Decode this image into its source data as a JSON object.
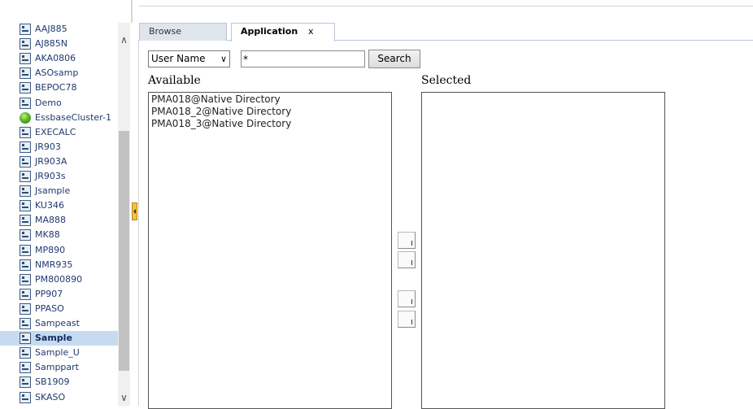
{
  "tree": {
    "items": [
      {
        "label": "AAJ885",
        "icon": "application-icon"
      },
      {
        "label": "AJ885N",
        "icon": "application-icon"
      },
      {
        "label": "AKA0806",
        "icon": "application-icon"
      },
      {
        "label": "ASOsamp",
        "icon": "application-icon"
      },
      {
        "label": "BEPOC78",
        "icon": "application-icon"
      },
      {
        "label": "Demo",
        "icon": "application-icon"
      },
      {
        "label": "EssbaseCluster-1",
        "icon": "cluster-icon"
      },
      {
        "label": "EXECALC",
        "icon": "application-icon"
      },
      {
        "label": "JR903",
        "icon": "application-icon"
      },
      {
        "label": "JR903A",
        "icon": "application-icon"
      },
      {
        "label": "JR903s",
        "icon": "application-icon"
      },
      {
        "label": "Jsample",
        "icon": "application-icon"
      },
      {
        "label": "KU346",
        "icon": "application-icon"
      },
      {
        "label": "MA888",
        "icon": "application-icon"
      },
      {
        "label": "MK88",
        "icon": "application-icon"
      },
      {
        "label": "MP890",
        "icon": "application-icon"
      },
      {
        "label": "NMR935",
        "icon": "application-icon"
      },
      {
        "label": "PM800890",
        "icon": "application-icon"
      },
      {
        "label": "PP907",
        "icon": "application-icon"
      },
      {
        "label": "PPASO",
        "icon": "application-icon"
      },
      {
        "label": "Sampeast",
        "icon": "application-icon"
      },
      {
        "label": "Sample",
        "icon": "application-icon",
        "selected": true
      },
      {
        "label": "Sample_U",
        "icon": "application-icon"
      },
      {
        "label": "Samppart",
        "icon": "application-icon"
      },
      {
        "label": "SB1909",
        "icon": "application-icon"
      },
      {
        "label": "SKASO",
        "icon": "application-icon"
      }
    ],
    "scroll_up_icon": "chevron-up-icon",
    "scroll_down_icon": "chevron-down-icon"
  },
  "tabs": [
    {
      "label": "Browse",
      "active": false
    },
    {
      "label": "Application",
      "active": true,
      "close_label": "x"
    }
  ],
  "search": {
    "type_selected": "User Name",
    "type_chevron": "∨",
    "query_value": "*",
    "button_label": "Search"
  },
  "available": {
    "heading": "Available",
    "options": [
      "PMA018@Native Directory",
      "PMA018_2@Native Directory",
      "PMA018_3@Native Directory"
    ]
  },
  "selected": {
    "heading": "Selected",
    "options": []
  },
  "colors": {
    "selection": "#c7dbf0",
    "tree_text": "#1f3a6e",
    "splitter_handle": "#f3c23c"
  }
}
